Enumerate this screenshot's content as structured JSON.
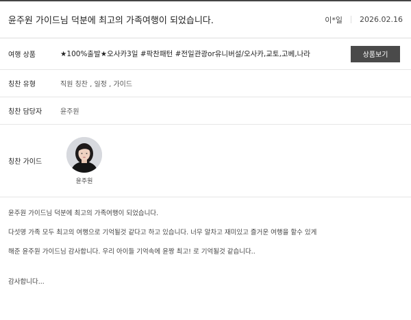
{
  "review": {
    "title": "윤주원 가이드님 덕분에 최고의 가족여행이 되었습니다.",
    "author": "이*일",
    "date": "2026.02.16"
  },
  "info": {
    "product_label": "여행 상품",
    "product_value": "★100%출발★오사카3일 #팍찬패턴 #전일관광or유니버설/오사카,교토,고베,나라",
    "product_button": "상품보기",
    "praise_type_label": "칭찬 유형",
    "praise_type_value": "직원 칭찬 , 일정 , 가이드",
    "staff_label": "칭찬 담당자",
    "staff_value": "윤주원",
    "guide_label": "칭찬 가이드",
    "guide_name": "윤주원"
  },
  "body": {
    "paragraphs": [
      "윤주원 가이드님 덕분에 최고의 가족여행이 되었습니다.",
      "다섯명 가족 모두 최고의 여행으로 기억될것 같다고 하고 있습니다. 너무 알차고 재미있고 즐거운 여행을 할수 있게",
      "해준 윤주원 가이드님 감사합니다. 우리 아이들 기억속에 윤짱 최고! 로 기억될것 같습니다..",
      "감사합니다..."
    ]
  },
  "colors": {
    "button_bg": "#4a4a4a",
    "top_border": "#444444",
    "divider": "#e6e6e6"
  }
}
